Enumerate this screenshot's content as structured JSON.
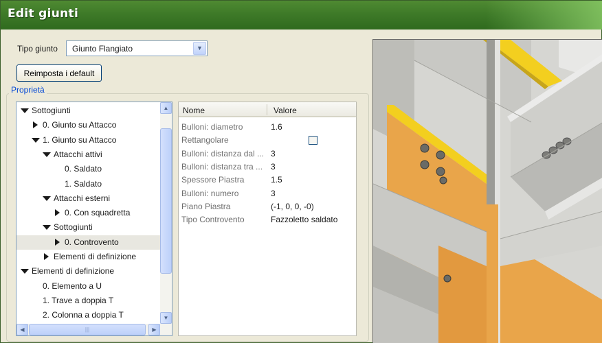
{
  "window": {
    "title": "Edit giunti"
  },
  "tipo_giunto": {
    "label": "Tipo giunto",
    "value": "Giunto Flangiato"
  },
  "reset_button": {
    "label": "Reimposta i default"
  },
  "properties_group": {
    "label": "Proprietà"
  },
  "tree": {
    "items": [
      {
        "label": "Sottogiunti",
        "level": 0,
        "toggle": "expanded"
      },
      {
        "label": "0. Giunto su Attacco",
        "level": 1,
        "toggle": "collapsed"
      },
      {
        "label": "1. Giunto su Attacco",
        "level": 1,
        "toggle": "expanded"
      },
      {
        "label": "Attacchi attivi",
        "level": 2,
        "toggle": "expanded"
      },
      {
        "label": "0. Saldato",
        "level": 3,
        "toggle": "none"
      },
      {
        "label": "1. Saldato",
        "level": 3,
        "toggle": "none"
      },
      {
        "label": "Attacchi esterni",
        "level": 2,
        "toggle": "expanded"
      },
      {
        "label": "0. Con squadretta",
        "level": 3,
        "toggle": "collapsed"
      },
      {
        "label": "Sottogiunti",
        "level": 2,
        "toggle": "expanded"
      },
      {
        "label": "0. Controvento",
        "level": 3,
        "toggle": "collapsed",
        "selected": true
      },
      {
        "label": "Elementi di definizione",
        "level": 2,
        "toggle": "collapsed"
      },
      {
        "label": "Elementi di definizione",
        "level": 0,
        "toggle": "expanded"
      },
      {
        "label": "0. Elemento a U",
        "level": 1,
        "toggle": "none"
      },
      {
        "label": "1. Trave a doppia T",
        "level": 1,
        "toggle": "none"
      },
      {
        "label": "2. Colonna a doppia T",
        "level": 1,
        "toggle": "none"
      }
    ]
  },
  "grid": {
    "headers": {
      "name": "Nome",
      "value": "Valore"
    },
    "rows": [
      {
        "name": "Bulloni: diametro",
        "value": "1.6"
      },
      {
        "name": "Rettangolare",
        "value": "",
        "checkbox": true,
        "checked": false
      },
      {
        "name": "Bulloni: distanza dal ...",
        "value": "3"
      },
      {
        "name": "Bulloni: distanza tra ...",
        "value": "3"
      },
      {
        "name": "Spessore Piastra",
        "value": "1.5"
      },
      {
        "name": "Bulloni: numero",
        "value": "3"
      },
      {
        "name": "Piano Piastra",
        "value": "(-1, 0, 0, -0)"
      },
      {
        "name": "Tipo Controvento",
        "value": "Fazzoletto saldato"
      }
    ]
  },
  "colors": {
    "titlebar": "#3e7a28",
    "plate_orange": "#e9a54a",
    "weld_yellow": "#f3cf1f",
    "steel_gray": "#c8c8c4"
  },
  "icons": {
    "combo": "chevron-down-icon",
    "expanded": "triangle-down-icon",
    "collapsed": "triangle-right-icon"
  }
}
